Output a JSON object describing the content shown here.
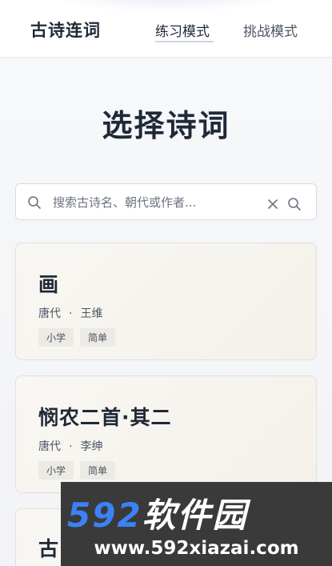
{
  "header": {
    "logo": "古诗连词",
    "tabs": [
      {
        "label": "练习模式",
        "active": true
      },
      {
        "label": "挑战模式",
        "active": false
      }
    ]
  },
  "main": {
    "title": "选择诗词",
    "search": {
      "placeholder": "搜索古诗名、朝代或作者...",
      "value": ""
    },
    "poems": [
      {
        "title": "画",
        "dynasty": "唐代",
        "separator": "·",
        "author": "王维",
        "tags": [
          "小学",
          "简单"
        ]
      },
      {
        "title": "悯农二首·其二",
        "dynasty": "唐代",
        "separator": "·",
        "author": "李绅",
        "tags": [
          "小学",
          "简单"
        ]
      },
      {
        "title": "古"
      }
    ]
  },
  "watermark": {
    "brand_number": "592",
    "brand_text": "软件园",
    "url": "www.592xiazai.com"
  },
  "colors": {
    "accent": "#1f2937",
    "background": "#f3f4f7",
    "card_bg": "#f7f5f0",
    "watermark_blue": "#3b82f6"
  }
}
